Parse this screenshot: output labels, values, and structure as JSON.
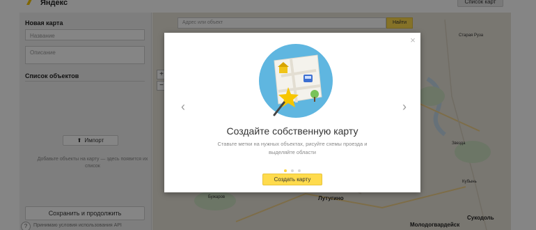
{
  "header": {
    "logo_text": "Яндекс",
    "right_button": "Список карт"
  },
  "left_panel": {
    "title": "Новая карта",
    "name_placeholder": "Название",
    "description_placeholder": "Описание",
    "objects_section": "Список объектов",
    "import_button": "Импорт",
    "hint": "Добавьте объекты на карту — здесь появится их список",
    "save_button": "Сохранить и продолжить",
    "terms": "Принимаю условия использования API",
    "help": "?"
  },
  "map": {
    "search_placeholder": "Адрес или объект",
    "find_button": "Найти",
    "zoom_in": "+",
    "zoom_out": "−",
    "labels": [
      "Старая Руза",
      "Бужаров",
      "Лутугино",
      "Молодогвардейск",
      "Сукодоль",
      "Звезда",
      "Кубынь"
    ],
    "water_color": "#c4d9e9",
    "land_color": "#e9e4d9"
  },
  "modal": {
    "close": "×",
    "prev": "‹",
    "next": "›",
    "title": "Создайте собственную карту",
    "description": "Ставьте метки на нужных объектах, рисуйте схемы проезда и выделяйте области",
    "dots": 3,
    "active_dot": 0,
    "create_button": "Создать карту",
    "accent": "#ffdb4d",
    "circle_color": "#5fb6e0"
  }
}
